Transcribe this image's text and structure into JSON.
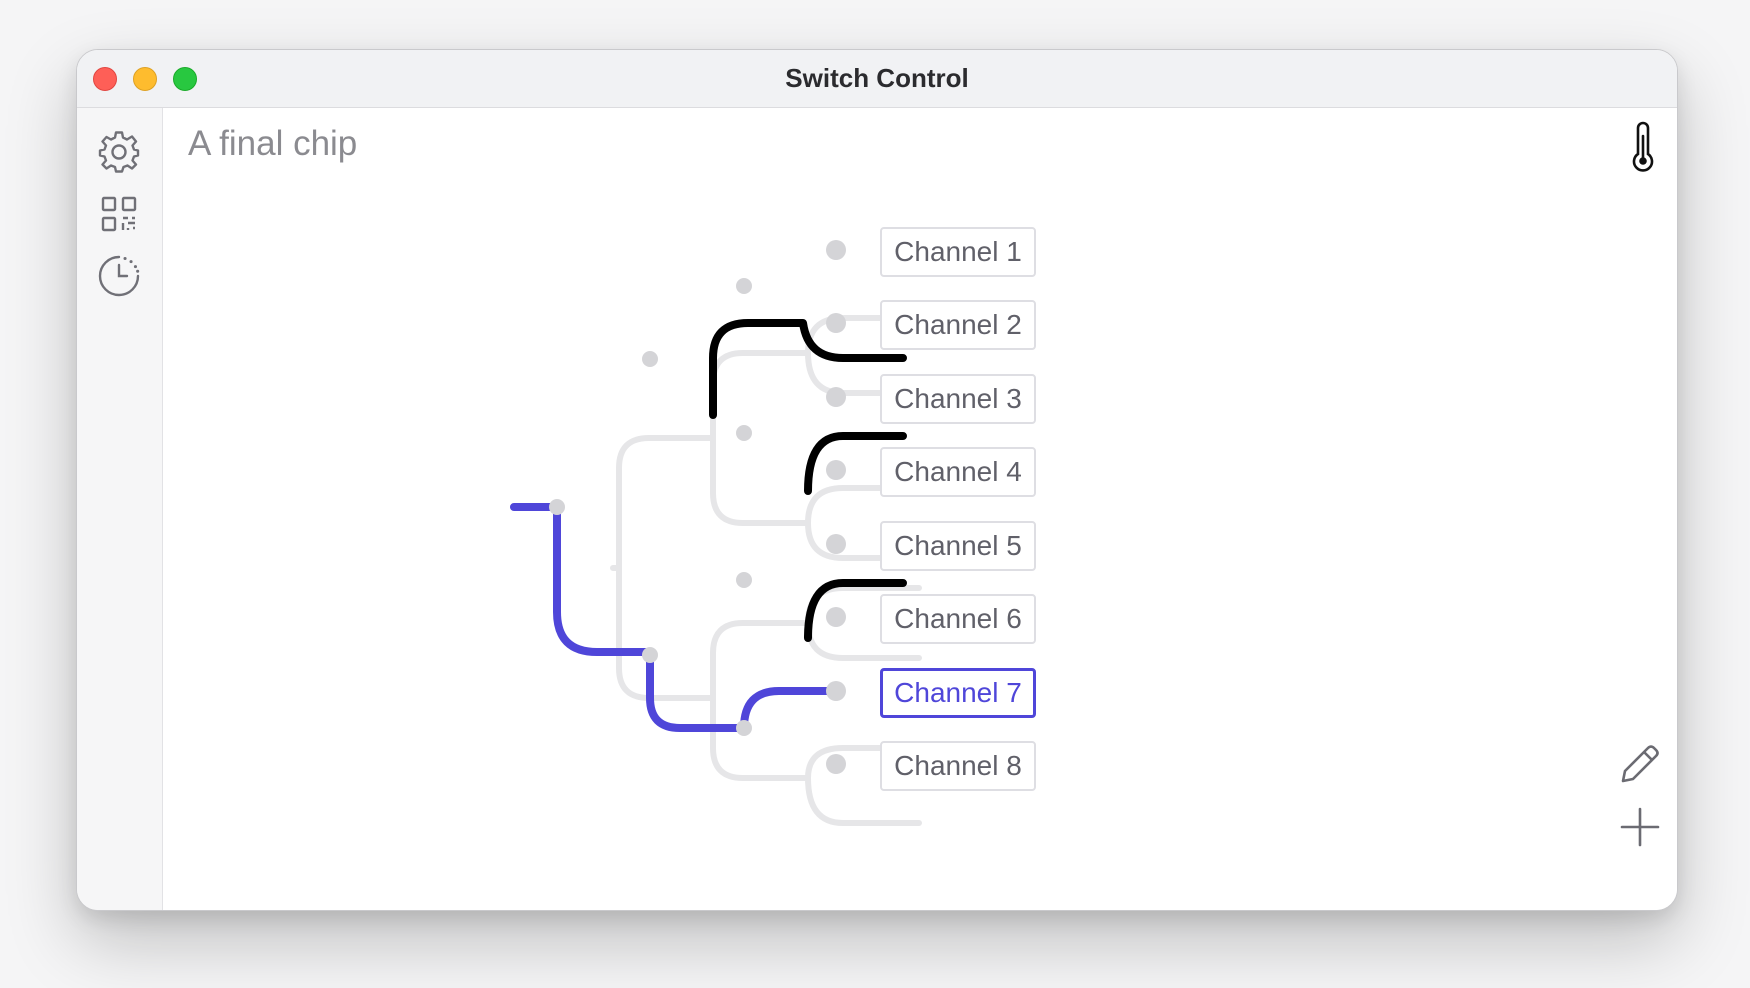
{
  "window": {
    "title": "Switch Control"
  },
  "sidebar": {
    "items": [
      {
        "icon": "gear-icon",
        "name": "settings"
      },
      {
        "icon": "qr-code-icon",
        "name": "qr-code"
      },
      {
        "icon": "timer-icon",
        "name": "history"
      }
    ]
  },
  "main": {
    "chip_name": "A final chip",
    "channels": [
      {
        "label": "Channel 1",
        "active": false
      },
      {
        "label": "Channel 2",
        "active": false
      },
      {
        "label": "Channel 3",
        "active": false
      },
      {
        "label": "Channel 4",
        "active": false
      },
      {
        "label": "Channel 5",
        "active": false
      },
      {
        "label": "Channel 6",
        "active": false
      },
      {
        "label": "Channel 7",
        "active": true
      },
      {
        "label": "Channel 8",
        "active": false
      }
    ],
    "selected_channel": "Channel 7",
    "tools": {
      "top_right": "thermometer-icon",
      "edit": "pencil-icon",
      "add": "plus-icon"
    }
  },
  "colors": {
    "accent": "#4f46d9",
    "switch_state": "#000000",
    "inactive_path": "#e4e4e6",
    "node": "#d6d6d9"
  }
}
